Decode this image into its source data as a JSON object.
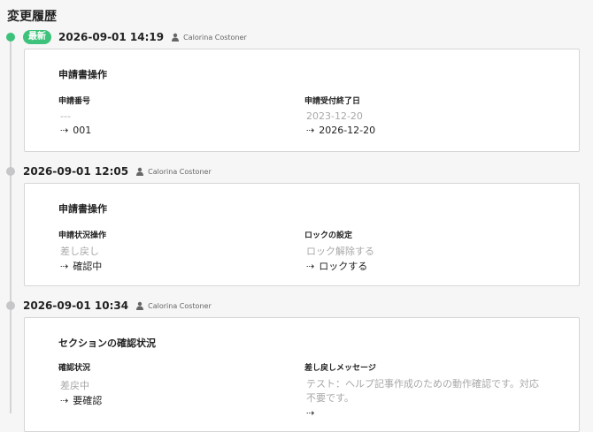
{
  "page": {
    "title": "変更履歴"
  },
  "entries": [
    {
      "badge": "最新",
      "date": "2026-09-01 14:19",
      "user": "Calorina Costoner",
      "section": "申請書操作",
      "fields": [
        {
          "label": "申請番号",
          "old": "---",
          "new": "001"
        },
        {
          "label": "申請受付終了日",
          "old": "2023-12-20",
          "new": "2026-12-20"
        }
      ]
    },
    {
      "date": "2026-09-01 12:05",
      "user": "Calorina Costoner",
      "section": "申請書操作",
      "fields": [
        {
          "label": "申請状況操作",
          "old": "差し戻し",
          "new": "確認中"
        },
        {
          "label": "ロックの設定",
          "old": "ロック解除する",
          "new": "ロックする"
        }
      ]
    },
    {
      "date": "2026-09-01 10:34",
      "user": "Calorina Costoner",
      "section": "セクションの確認状況",
      "fields": [
        {
          "label": "確認状況",
          "old": "差戻中",
          "new": "要確認"
        },
        {
          "label": "差し戻しメッセージ",
          "old": "テスト：ヘルプ記事作成のための動作確認です。対応不要です。",
          "new": ""
        }
      ]
    }
  ],
  "icons": {
    "arrow": "dotted-arrow-right-icon",
    "user": "person-icon"
  },
  "colors": {
    "latest": "#3cc27a",
    "dot": "#c6c6c8",
    "old_value": "#a8a8aa"
  }
}
